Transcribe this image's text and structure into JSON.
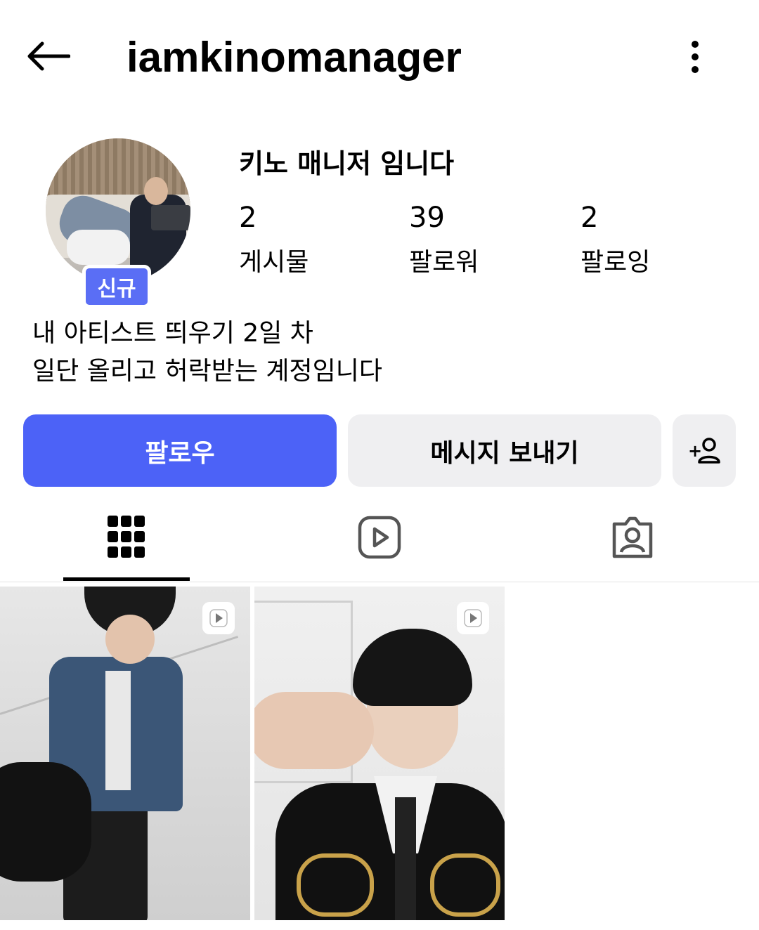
{
  "header": {
    "username": "iamkinomanager"
  },
  "profile": {
    "display_name": "키노 매니저 임니다",
    "new_badge": "신규",
    "stats": {
      "posts": {
        "value": "2",
        "label": "게시물"
      },
      "followers": {
        "value": "39",
        "label": "팔로워"
      },
      "following": {
        "value": "2",
        "label": "팔로잉"
      }
    },
    "bio": [
      "내 아티스트 띄우기 2일 차",
      "일단 올리고 허락받는 계정임니다"
    ]
  },
  "actions": {
    "follow_label": "팔로우",
    "message_label": "메시지 보내기",
    "add_label": "+"
  },
  "tabs": [
    "grid-icon",
    "reels-icon",
    "tagged-icon"
  ],
  "selected_tab": "grid-icon",
  "posts": [
    {
      "type": "reel",
      "icon": "play-icon"
    },
    {
      "type": "reel",
      "icon": "play-icon"
    }
  ],
  "colors": {
    "follow_button": "#4c62f7",
    "new_badge": "#5a6ef5",
    "secondary_button": "#efeff1"
  }
}
